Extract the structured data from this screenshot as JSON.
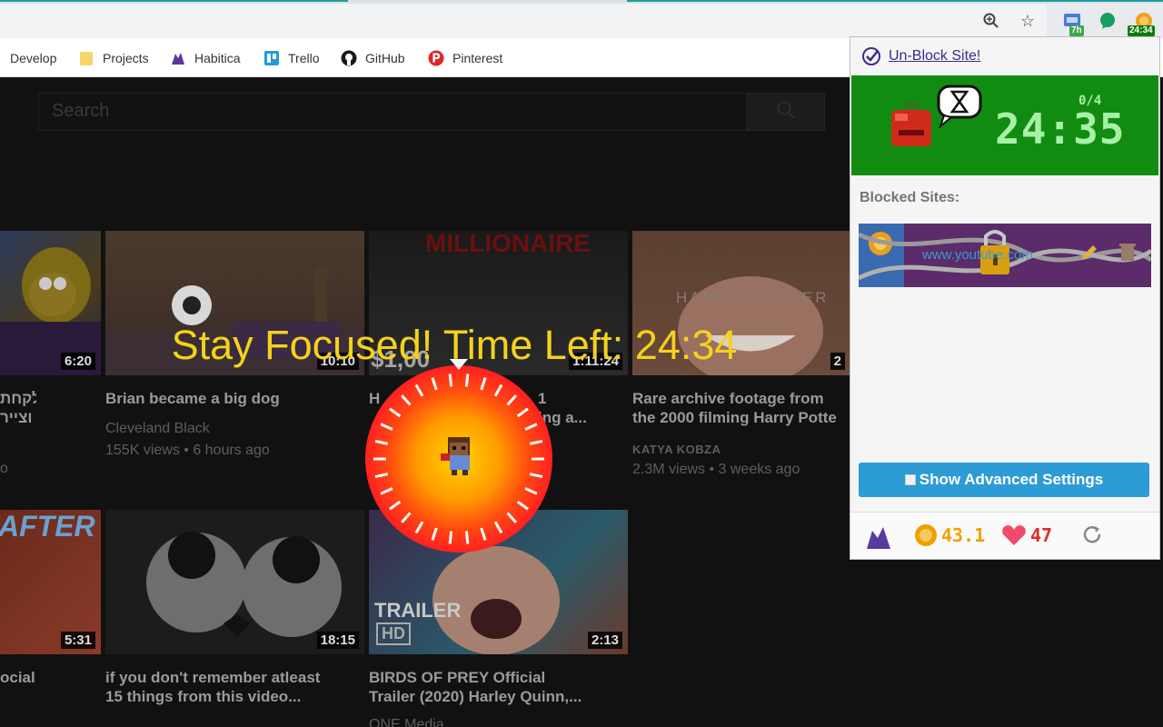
{
  "browser": {
    "extension_badge_7h": "7h",
    "extension_badge_timer": "24:34"
  },
  "bookmarks": [
    {
      "label": "Develop"
    },
    {
      "label": "Projects"
    },
    {
      "label": "Habitica"
    },
    {
      "label": "Trello"
    },
    {
      "label": "GitHub"
    },
    {
      "label": "Pinterest"
    }
  ],
  "youtube": {
    "search_placeholder": "Search",
    "overlay_text": "Stay Focused! Time Left: 24:34",
    "videos": [
      {
        "duration": "6:20",
        "title_line1": "לקחת",
        "title_line2": "וצייר",
        "meta1": "",
        "meta2": "o"
      },
      {
        "duration": "10:10",
        "title_line1": "Brian became a big dog",
        "title_line2": "",
        "meta1": "Cleveland Black",
        "meta2": "155K views • 6 hours ago"
      },
      {
        "duration": "1:11:24",
        "overlay": "MILLIONAIRE",
        "price": "$1,00",
        "title_line1": "H",
        "title_line2": "",
        "title_tail1": "1",
        "title_tail2": "ing a..."
      },
      {
        "duration": "2",
        "overlay": "HARRY POTTER",
        "title_line1": "Rare archive footage from",
        "title_line2": "the 2000 filming Harry Potte",
        "meta1": "KATYA KOBZA",
        "meta2": "2.3M views • 3 weeks ago"
      },
      {
        "duration": "5:31",
        "overlay": "AFTER",
        "title_line1": "ocial",
        "title_line2": ""
      },
      {
        "duration": "18:15",
        "title_line1": "if you don't remember atleast",
        "title_line2": "15 things from this video..."
      },
      {
        "duration": "2:13",
        "overlay": "TRAILER",
        "overlay2": "HD",
        "title_line1": "BIRDS OF PREY Official",
        "title_line2": "Trailer (2020) Harley Quinn,...",
        "meta1": "ONE Media"
      }
    ]
  },
  "popup": {
    "unblock_label": "Un-Block Site!",
    "pomodoro_count": "0/4",
    "timer": "24:35",
    "blocked_label": "Blocked Sites:",
    "blocked_site": "www.youtube.com",
    "advanced_button": "Show Advanced Settings",
    "gold": "43.1",
    "health": "47"
  },
  "colors": {
    "overlay_text": "#f5d21b",
    "popup_green": "#118c11",
    "timer_text": "#a8f0a8",
    "advanced_btn": "#2d9bd6"
  }
}
